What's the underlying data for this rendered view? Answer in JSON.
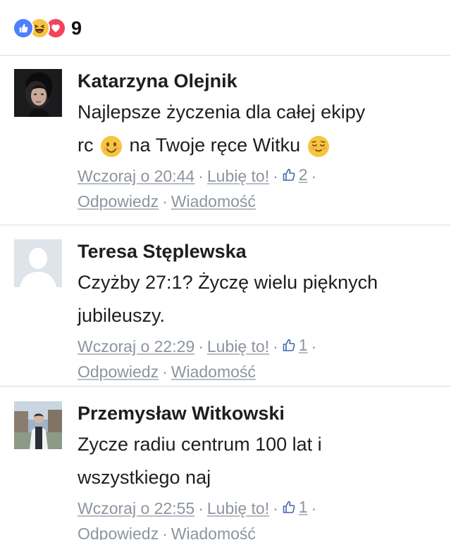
{
  "reactions": {
    "icons": [
      "like-icon",
      "haha-icon",
      "love-icon"
    ],
    "count": "9",
    "colors": {
      "like": "#4d80ff",
      "haha": "#f7c341",
      "love": "#f2435b"
    }
  },
  "comments": [
    {
      "author": "Katarzyna Olejnik",
      "text_line1": "Najlepsze życzenia dla całej ekipy",
      "text_line2a": "rc",
      "text_line2b": "na Twoje ręce Witku",
      "emojis": [
        "smiling-face-emoji",
        "relieved-face-emoji"
      ],
      "time": "Wczoraj o 20:44",
      "like_label": "Lubię to!",
      "like_count": "2",
      "reply_label": "Odpowiedz",
      "message_label": "Wiadomość"
    },
    {
      "author": "Teresa Stęplewska",
      "text_line1": "Czyżby 27:1? Życzę wielu pięknych",
      "text_line2": "jubileuszy.",
      "time": "Wczoraj o 22:29",
      "like_label": "Lubię to!",
      "like_count": "1",
      "reply_label": "Odpowiedz",
      "message_label": "Wiadomość"
    },
    {
      "author": "Przemysław Witkowski",
      "text_line1": "Zycze radiu centrum 100 lat i",
      "text_line2": "wszystkiego naj",
      "time": "Wczoraj o 22:55",
      "like_label": "Lubię to!",
      "like_count": "1",
      "reply_label": "Odpowiedz",
      "message_label": "Wiadomość"
    }
  ]
}
